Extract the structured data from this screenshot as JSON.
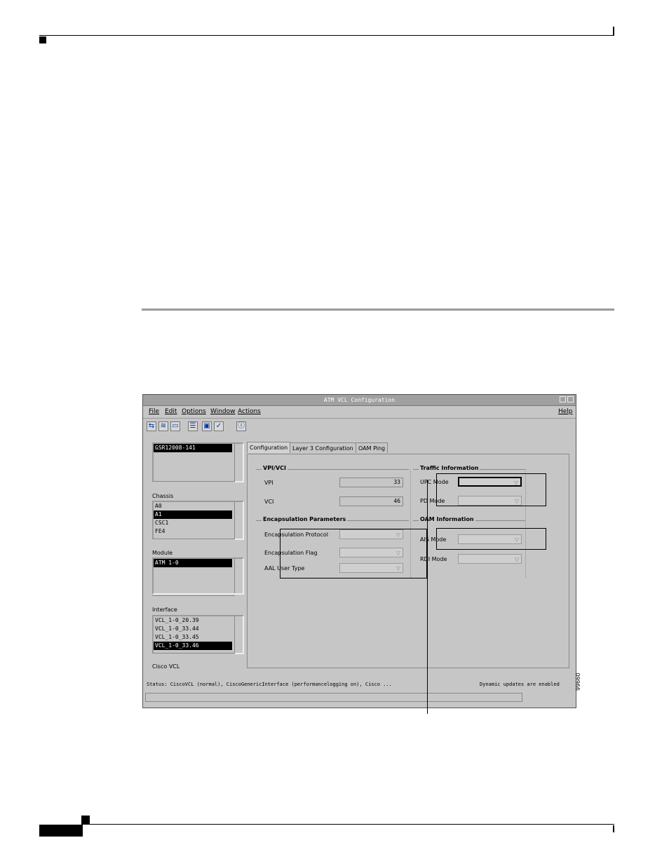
{
  "figure_number": "99660",
  "window": {
    "title": "ATM VCL Configuration",
    "menus": [
      "File",
      "Edit",
      "Options",
      "Window",
      "Actions"
    ],
    "help_menu": "Help"
  },
  "toolbar_icons": [
    "open-icon",
    "layers-icon",
    "folder-icon",
    "list-icon",
    "monitor-icon",
    "check-icon",
    "info-icon"
  ],
  "left_panel": {
    "top_list": [
      "GSR12008-141"
    ],
    "chassis_label": "Chassis",
    "chassis_list": [
      "A0",
      "A1",
      "CSC1",
      "FE4"
    ],
    "module_label": "Module",
    "module_list": [
      "ATM 1-0"
    ],
    "interface_label": "Interface",
    "interface_list": [
      "VCL_1-0_20.39",
      "VCL_1-0_33.44",
      "VCL_1-0_33.45",
      "VCL_1-0_33.46"
    ],
    "object_type": "Cisco VCL"
  },
  "tabs": [
    "Configuration",
    "Layer 3 Configuration",
    "OAM Ping"
  ],
  "vpi_vci": {
    "title": "VPI/VCI",
    "vpi_label": "VPI",
    "vpi_value": "33",
    "vci_label": "VCI",
    "vci_value": "46"
  },
  "encapsulation": {
    "title": "Encapsulation Parameters",
    "protocol_label": "Encapsulation Protocol",
    "flag_label": "Encapsulation Flag",
    "aal_label": "AAL User Type"
  },
  "traffic": {
    "title": "Traffic Information",
    "upc_label": "UPC Mode",
    "pd_label": "PD Mode"
  },
  "oam": {
    "title": "OAM Information",
    "ais_label": "AIS Mode",
    "rdi_label": "RDI Mode"
  },
  "status": {
    "text": "Status: CiscoVCL (normal), CiscoGenericInterface (performancelogging on), Cisco ...",
    "updates": "Dynamic updates are enabled"
  }
}
